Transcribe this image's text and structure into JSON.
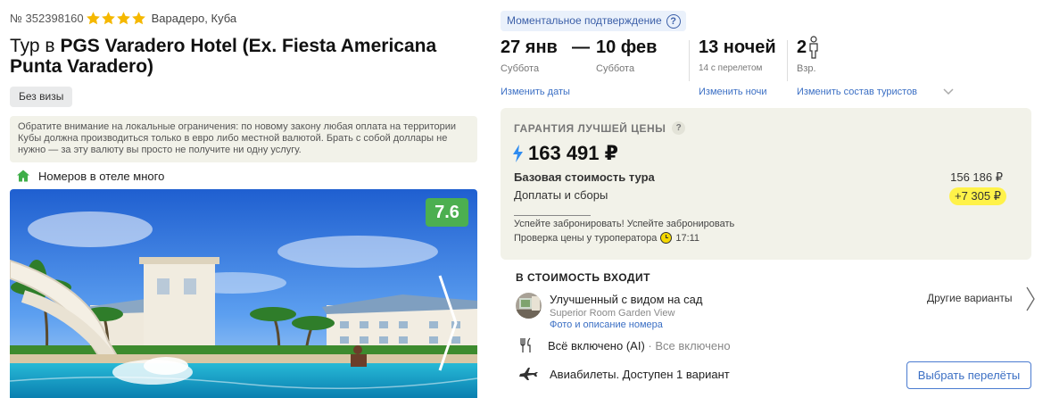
{
  "hotel": {
    "tour_number": "№ 352398160",
    "stars": 4,
    "location": "Варадеро, Куба",
    "title_prefix": "Тур в",
    "title_name": "PGS Varadero Hotel (Ex. Fiesta Americana Punta Varadero)",
    "visa_badge": "Без визы",
    "notice": "Обратите внимание на локальные ограничения: по новому закону любая оплата на территории Кубы должна производиться только в евро либо местной валютой. Брать с собой доллары не нужно — за эту валюту вы просто не получите ни одну услугу.",
    "rooms_note": "Номеров в отеле много",
    "rating": "7.6"
  },
  "booking": {
    "instant_confirmation": "Моментальное подтверждение",
    "date_from": "27 янв",
    "date_dash": "—",
    "date_to": "10 фев",
    "day_from": "Суббота",
    "day_to": "Суббота",
    "nights": "13 ночей",
    "nights_sub": "14 с перелетом",
    "tourists": "2",
    "tourists_sub": "Взр.",
    "change_dates": "Изменить даты",
    "change_nights": "Изменить ночи",
    "change_tourists": "Изменить состав туристов"
  },
  "price": {
    "guarantee": "ГАРАНТИЯ ЛУЧШЕЙ ЦЕНЫ",
    "total": "163 491 ₽",
    "base_label": "Базовая стоимость тура",
    "base_value": "156 186 ₽",
    "fees_label": "Доплаты и сборы",
    "fees_value": "+7 305 ₽",
    "hurry": "Успейте забронировать! Успейте забронировать",
    "check_label": "Проверка цены у туроператора",
    "check_time": "17:11"
  },
  "included": {
    "title": "В СТОИМОСТЬ ВХОДИТ",
    "room_name": "Улучшенный с видом на сад",
    "room_sub": "Superior Room Garden View",
    "room_link": "Фото и описание номера",
    "other_options": "Другие варианты",
    "meal": "Всё включено (AI)",
    "meal_extra": " · Все включено",
    "flights": "Авиабилеты. Доступен 1 вариант",
    "select_flights": "Выбрать перелёты"
  },
  "colors": {
    "accent_blue": "#3b6fc4",
    "rating_green": "#4caf50",
    "price_card_bg": "#f2f2e9",
    "fee_highlight": "#fff249",
    "star_gold": "#f5b800"
  }
}
